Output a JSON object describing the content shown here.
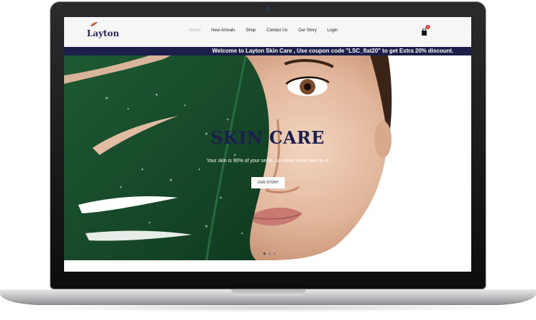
{
  "brand": {
    "name": "Layton",
    "accent": "#2a1f5c"
  },
  "nav": {
    "items": [
      {
        "label": "Home",
        "active": true
      },
      {
        "label": "New Arrivals",
        "active": false
      },
      {
        "label": "Shop",
        "active": false
      },
      {
        "label": "Contact Us",
        "active": false
      },
      {
        "label": "Our Story",
        "active": false
      },
      {
        "label": "Login",
        "active": false
      }
    ]
  },
  "cart": {
    "count": "0",
    "icon": "shopping-bag-icon"
  },
  "announcement": {
    "text": "Welcome to Layton Skin Care , Use coupon code \"LSC_flat20\" to get Extra 20% discount.",
    "bg": "#1c1f4a"
  },
  "hero": {
    "title": "SKIN CARE",
    "subtitle": "Your skin is 90% of your selfie, so show some love to it!",
    "button_label": "OUR STORY",
    "title_color": "#1b1f4f"
  },
  "slider": {
    "slides": 3,
    "active": 1
  }
}
